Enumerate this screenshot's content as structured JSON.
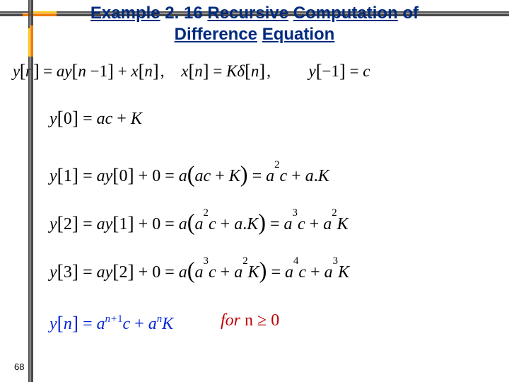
{
  "title_parts": {
    "ex": "Example",
    "num": "2. 16",
    "rec": "Recursive",
    "comp": "Computation",
    "of": "of",
    "diff": "Difference",
    "eqn": "Equation"
  },
  "page_number": "68",
  "eq": {
    "def": "y[n] = a y[n − 1] + x[n],   x[n] = K δ[n],   y[−1] = c",
    "y0": "y[0] = ac + K",
    "y1": "y[1] = a y[0] + 0 = a(ac + K) = a²c + a.K",
    "y2": "y[2] = a y[1] + 0 = a(a²c + a.K) = a³c + a²K",
    "y3": "y[3] = a y[2] + 0 = a(a³c + a²K) = a⁴c + a³K",
    "yn": "y[n] = aⁿ⁺¹c + aⁿK",
    "cond": "for n ≥ 0"
  },
  "chart_data": {
    "type": "table",
    "title": "Example 2.16 Recursive Computation of Difference Equation",
    "equations": [
      "y[n] = a·y[n-1] + x[n]",
      "x[n] = K·δ[n]",
      "y[-1] = c"
    ],
    "recursion": [
      {
        "n": 0,
        "y": "a·c + K"
      },
      {
        "n": 1,
        "y": "a²·c + a·K"
      },
      {
        "n": 2,
        "y": "a³·c + a²·K"
      },
      {
        "n": 3,
        "y": "a⁴·c + a³·K"
      }
    ],
    "closed_form": "y[n] = a^(n+1)·c + aⁿ·K  for n ≥ 0"
  }
}
